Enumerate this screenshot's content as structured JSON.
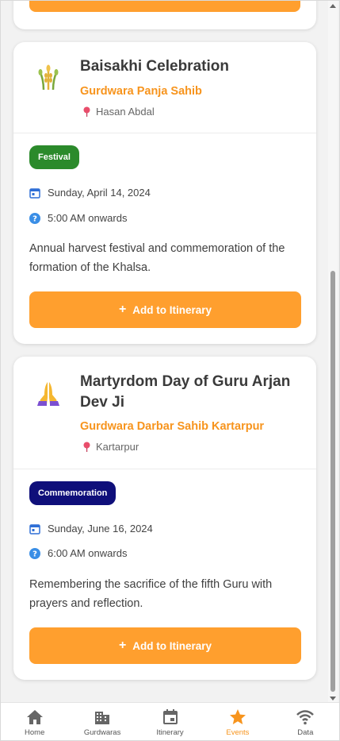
{
  "events": [
    {
      "title": "Baisakhi Celebration",
      "gurdwara": "Gurdwara Panja Sahib",
      "location": "Hasan Abdal",
      "category": "Festival",
      "date": "Sunday, April 14, 2024",
      "time": "5:00 AM onwards",
      "description": "Annual harvest festival and commemoration of the formation of the Khalsa.",
      "button_label": "Add to Itinerary",
      "icon": "wheat-icon"
    },
    {
      "title": "Martyrdom Day of Guru Arjan Dev Ji",
      "gurdwara": "Gurdwara Darbar Sahib Kartarpur",
      "location": "Kartarpur",
      "category": "Commemoration",
      "date": "Sunday, June 16, 2024",
      "time": "6:00 AM onwards",
      "description": "Remembering the sacrifice of the fifth Guru with prayers and reflection.",
      "button_label": "Add to Itinerary",
      "icon": "praying-hands-icon"
    }
  ],
  "nav": {
    "items": [
      {
        "label": "Home",
        "icon": "home-icon"
      },
      {
        "label": "Gurdwaras",
        "icon": "building-icon"
      },
      {
        "label": "Itinerary",
        "icon": "calendar-icon"
      },
      {
        "label": "Events",
        "icon": "star-icon",
        "active": true
      },
      {
        "label": "Data",
        "icon": "wifi-icon"
      }
    ]
  },
  "colors": {
    "accent": "#f7941d",
    "button": "#ff9f2e",
    "festival_badge": "#2b8a2b",
    "commemoration_badge": "#0f0f7a"
  }
}
